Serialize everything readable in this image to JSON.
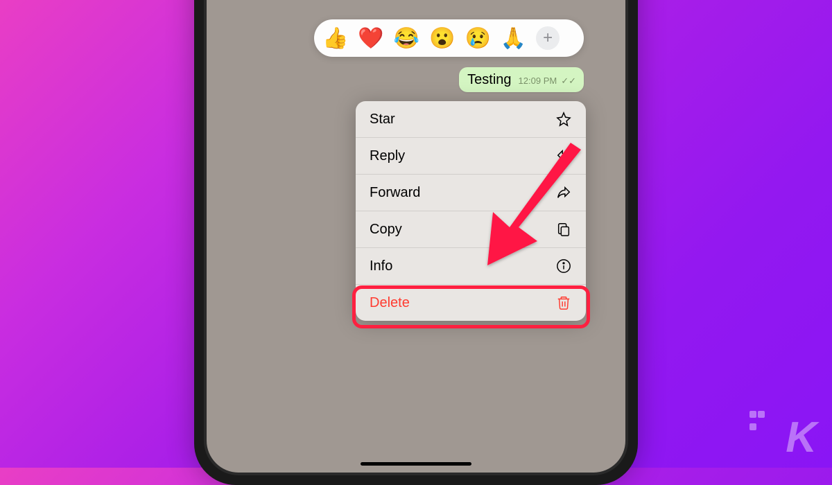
{
  "reactions": {
    "emojis": [
      "👍",
      "❤️",
      "😂",
      "😮",
      "😢",
      "🙏"
    ],
    "add_symbol": "+"
  },
  "message": {
    "text": "Testing",
    "time": "12:09 PM",
    "checks": "✓✓"
  },
  "menu": {
    "star": "Star",
    "reply": "Reply",
    "forward": "Forward",
    "copy": "Copy",
    "info": "Info",
    "delete": "Delete"
  },
  "colors": {
    "delete": "#ff3b30",
    "highlight": "#ff2040"
  }
}
